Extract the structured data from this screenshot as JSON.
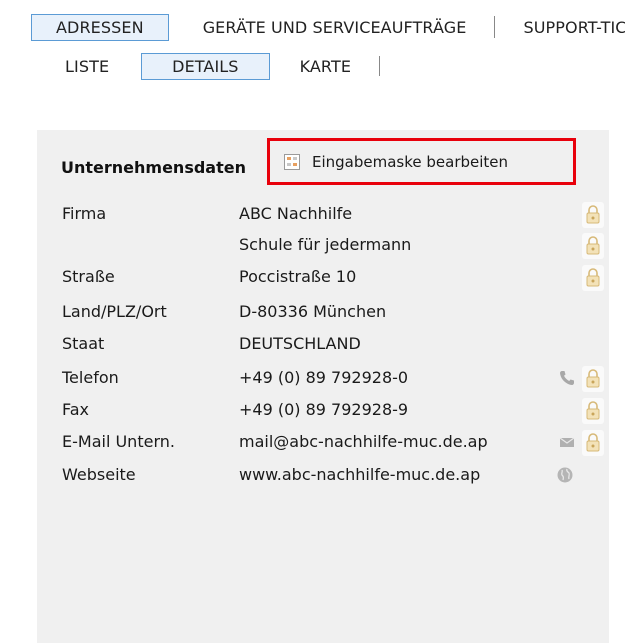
{
  "tabs_main": [
    "ADRESSEN",
    "GERÄTE UND SERVICEAUFTRÄGE",
    "SUPPORT-TIC"
  ],
  "tabs_sub": [
    "LISTE",
    "DETAILS",
    "KARTE"
  ],
  "panel": {
    "title": "Unternehmensdaten",
    "edit_button_label": "Eingabemaske bearbeiten",
    "rows": [
      {
        "label": "Firma",
        "value": "ABC Nachhilfe"
      },
      {
        "label": "",
        "value": "Schule für jedermann"
      },
      {
        "label": "Straße",
        "value": "Poccistraße 10"
      },
      {
        "label": "Land/PLZ/Ort",
        "value": "D-80336 München"
      },
      {
        "label": "Staat",
        "value": "DEUTSCHLAND"
      },
      {
        "label": "Telefon",
        "value": "+49 (0) 89 792928-0"
      },
      {
        "label": "Fax",
        "value": "+49 (0) 89 792928-9"
      },
      {
        "label": "E-Mail Untern.",
        "value": "mail@abc-nachhilfe-muc.de.ap"
      },
      {
        "label": "Webseite",
        "value": "www.abc-nachhilfe-muc.de.ap"
      }
    ]
  },
  "icons": {
    "lock": "lock-icon",
    "phone": "phone-icon",
    "mail": "mail-icon",
    "web": "globe-icon",
    "edit": "edit-form-icon"
  },
  "colors": {
    "active_tab_border": "#5b9bd5",
    "active_tab_bg": "#e8f1fb",
    "highlight_border": "#e8000b",
    "panel_bg": "#f0f0f0",
    "lock_color": "#d7b978"
  }
}
